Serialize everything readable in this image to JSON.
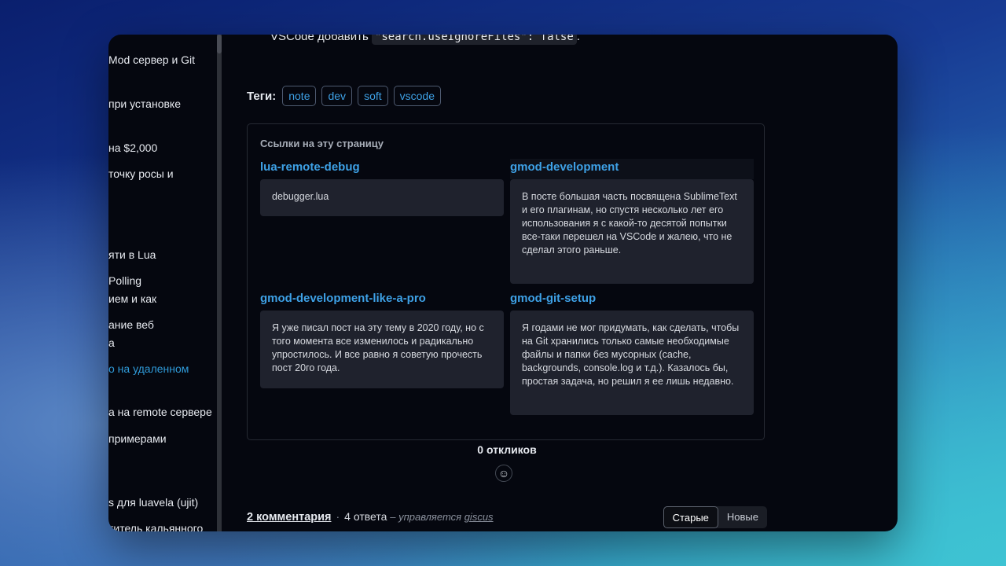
{
  "sidebar": {
    "items": [
      {
        "label": "Mod сервер и Git"
      },
      {
        "label": "при установке"
      },
      {
        "label": " на $2,000"
      },
      {
        "label": " точку росы и"
      },
      {
        "label": "яти в Lua"
      },
      {
        "label": "Polling"
      },
      {
        "label": "ием и как"
      },
      {
        "label": "ание веб"
      },
      {
        "label": "а"
      },
      {
        "label": "о на удаленном"
      },
      {
        "label": "а на remote сервере"
      },
      {
        "label": "примерами"
      },
      {
        "label": "s для luavela (ujit)"
      },
      {
        "label": "титель кальянного"
      }
    ]
  },
  "article": {
    "intro_text": "VSCode добавить ",
    "code": "\"search.useIgnoreFiles\": false",
    "intro_end": "."
  },
  "tags": {
    "label": "Теги:",
    "items": [
      "note",
      "dev",
      "soft",
      "vscode"
    ]
  },
  "backlinks": {
    "title": "Ссылки на эту страницу",
    "items": [
      {
        "link": "lua-remote-debug",
        "excerpt": "debugger.lua"
      },
      {
        "link": "gmod-development",
        "excerpt": "В посте большая часть посвящена SublimeText и его плагинам, но спустя несколько лет его использования я с какой-то десятой попытки все-таки перешел на VSCode и жалею, что не сделал этого раньше."
      },
      {
        "link": "gmod-development-like-a-pro",
        "excerpt": "Я уже писал пост на эту тему в 2020 году, но с того момента все изменилось и радикально упростилось. И все равно я советую прочесть пост 20го года."
      },
      {
        "link": "gmod-git-setup",
        "excerpt": "Я годами не мог придумать, как сделать, чтобы на Git хранились только самые необходимые файлы и папки без мусорных (cache, backgrounds, console.log и т.д.). Казалось бы, простая задача, но решил я ее лишь недавно."
      }
    ]
  },
  "reactions": {
    "count_label": "0 откликов",
    "icon": "smile-icon"
  },
  "comments": {
    "count_label": "2 комментария",
    "separator": "·",
    "replies_label": "4 ответа",
    "managed_prefix": "– управляется ",
    "managed_by": "giscus",
    "sort": {
      "oldest": "Старые",
      "newest": "Новые",
      "selected": "Старые"
    }
  }
}
